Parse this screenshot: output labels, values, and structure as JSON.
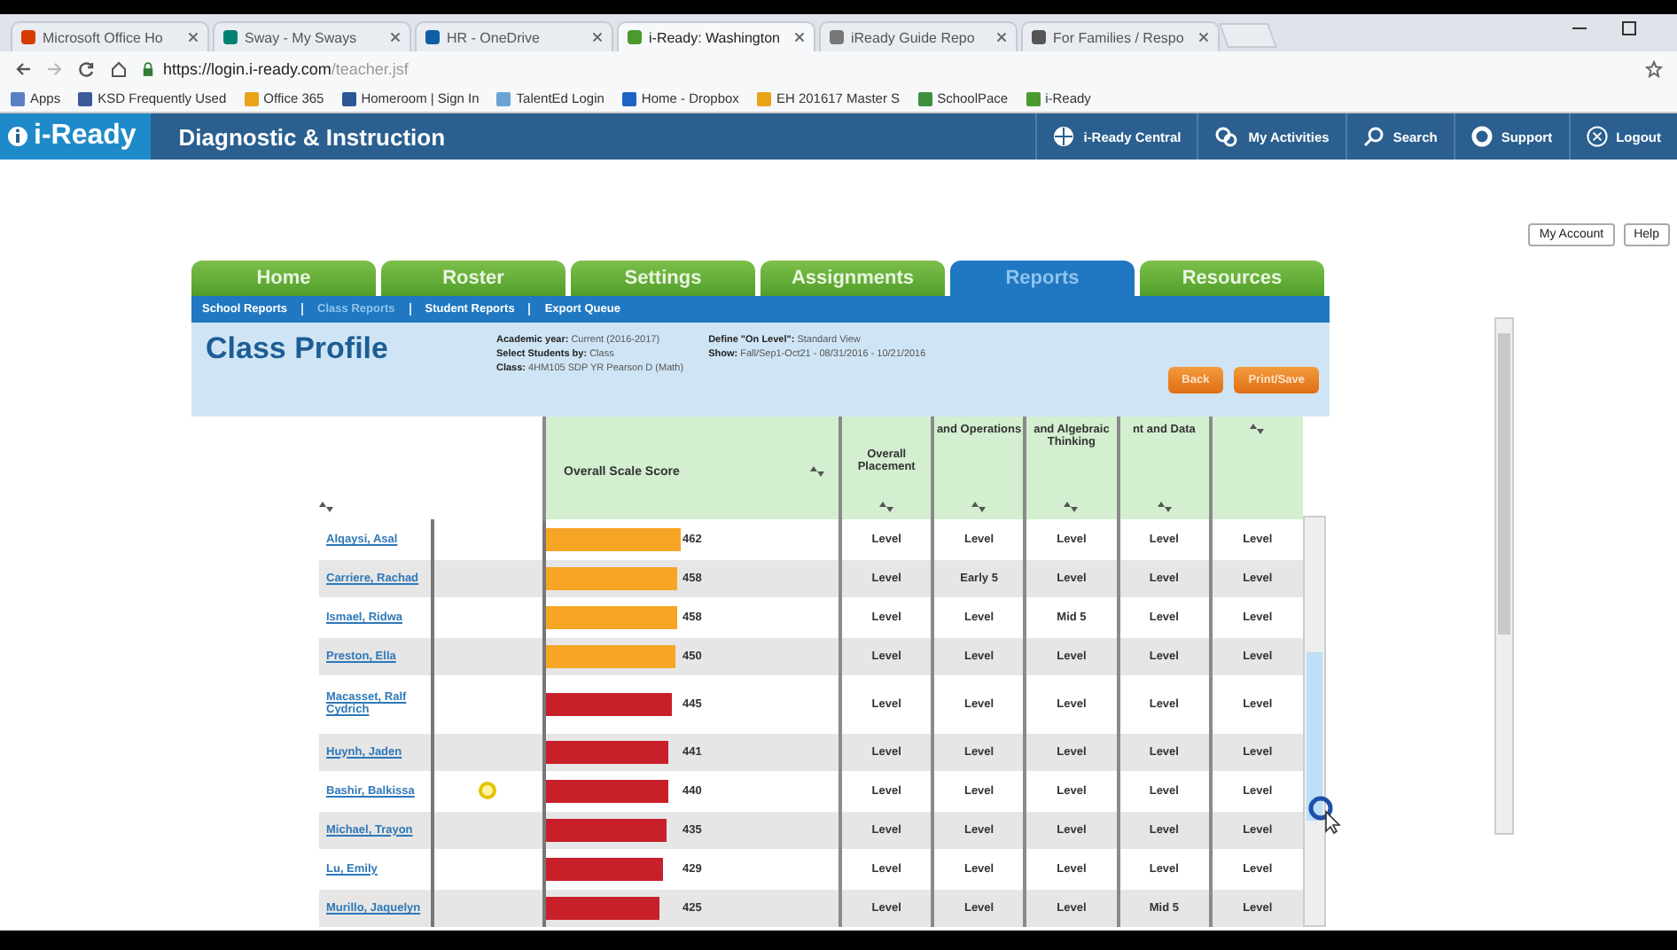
{
  "browser": {
    "tabs": [
      {
        "title": "Microsoft Office Ho",
        "selected": false,
        "color": "#d83b01"
      },
      {
        "title": "Sway - My Sways",
        "selected": false,
        "color": "#008272"
      },
      {
        "title": "HR - OneDrive",
        "selected": false,
        "color": "#0f5ea8"
      },
      {
        "title": "i-Ready: Washington",
        "selected": true,
        "color": "#4a9a2e"
      },
      {
        "title": "iReady Guide Repo",
        "selected": false,
        "color": "#777777"
      },
      {
        "title": "For Families / Respo",
        "selected": false,
        "color": "#555555"
      }
    ],
    "url_host": "https://login.i-ready.com",
    "url_path": "/teacher.jsf",
    "bookmarks": [
      {
        "title": "Apps",
        "color": "#5b7fc4"
      },
      {
        "title": "KSD Frequently Used",
        "color": "#3a5a9a"
      },
      {
        "title": "Office 365",
        "color": "#e8a317"
      },
      {
        "title": "Homeroom | Sign In",
        "color": "#2b5797"
      },
      {
        "title": "TalentEd Login",
        "color": "#6aa3d6"
      },
      {
        "title": "Home - Dropbox",
        "color": "#1e63c4"
      },
      {
        "title": "EH 201617 Master S",
        "color": "#e8a317"
      },
      {
        "title": "SchoolPace",
        "color": "#3f8f3f"
      },
      {
        "title": "i-Ready",
        "color": "#4a9a2e"
      }
    ]
  },
  "app_header": {
    "logo": "i-Ready",
    "title": "Diagnostic & Instruction",
    "nav": [
      "i-Ready Central",
      "My Activities",
      "Search",
      "Support",
      "Logout"
    ]
  },
  "account_buttons": [
    "My Account",
    "Help"
  ],
  "main_tabs": [
    {
      "label": "Home",
      "selected": false
    },
    {
      "label": "Roster",
      "selected": false
    },
    {
      "label": "Settings",
      "selected": false
    },
    {
      "label": "Assignments",
      "selected": false
    },
    {
      "label": "Reports",
      "selected": true
    },
    {
      "label": "Resources",
      "selected": false
    }
  ],
  "sub_nav": [
    {
      "label": "School Reports",
      "selected": false
    },
    {
      "label": "Class Reports",
      "selected": true
    },
    {
      "label": "Student Reports",
      "selected": false
    },
    {
      "label": "Export Queue",
      "selected": false
    }
  ],
  "report": {
    "title": "Class Profile",
    "filters": [
      {
        "label": "Academic year:",
        "value": "Current (2016-2017)"
      },
      {
        "label": "Select Students by:",
        "value": "Class"
      },
      {
        "label": "Class:",
        "value": "4HM105 SDP YR Pearson D (Math)"
      }
    ],
    "filters_right": [
      {
        "label": "Define \"On Level\":",
        "value": "Standard View"
      },
      {
        "label": "Show:",
        "value": "Fall/Sep1-Oct21 - 08/31/2016 - 10/21/2016"
      }
    ],
    "buttons": [
      "Back",
      "Print/Save"
    ]
  },
  "table": {
    "score_header": "Overall Scale Score",
    "columns": [
      "Overall Placement",
      "and Operations",
      "and Algebraic Thinking",
      "nt and Data"
    ],
    "rows": [
      {
        "name": "Alqaysi, Asal",
        "flagged": false,
        "score": "462",
        "level": 0.46,
        "color": "#f6a524",
        "cells": [
          "Level",
          "Level",
          "Level",
          "Level",
          "Level"
        ]
      },
      {
        "name": "Carriere, Rachad",
        "flagged": false,
        "score": "458",
        "level": 0.45,
        "color": "#f6a524",
        "cells": [
          "Level",
          "Early 5",
          "Level",
          "Level",
          "Level"
        ]
      },
      {
        "name": "Ismael, Ridwa",
        "flagged": false,
        "score": "458",
        "level": 0.45,
        "color": "#f6a524",
        "cells": [
          "Level",
          "Level",
          "Mid 5",
          "Level",
          "Level"
        ]
      },
      {
        "name": "Preston, Ella",
        "flagged": false,
        "score": "450",
        "level": 0.44,
        "color": "#f6a524",
        "cells": [
          "Level",
          "Level",
          "Level",
          "Level",
          "Level"
        ]
      },
      {
        "name": "Macasset, Ralf Cydrich",
        "flagged": false,
        "score": "445",
        "level": 0.43,
        "color": "#c8202a",
        "cells": [
          "Level",
          "Level",
          "Level",
          "Level",
          "Level"
        ]
      },
      {
        "name": "Huynh, Jaden",
        "flagged": false,
        "score": "441",
        "level": 0.42,
        "color": "#c8202a",
        "cells": [
          "Level",
          "Level",
          "Level",
          "Level",
          "Level"
        ]
      },
      {
        "name": "Bashir, Balkissa",
        "flagged": true,
        "score": "440",
        "level": 0.42,
        "color": "#c8202a",
        "cells": [
          "Level",
          "Level",
          "Level",
          "Level",
          "Level"
        ]
      },
      {
        "name": "Michael, Trayon",
        "flagged": false,
        "score": "435",
        "level": 0.41,
        "color": "#c8202a",
        "cells": [
          "Level",
          "Level",
          "Level",
          "Level",
          "Level"
        ]
      },
      {
        "name": "Lu, Emily",
        "flagged": false,
        "score": "429",
        "level": 0.4,
        "color": "#c8202a",
        "cells": [
          "Level",
          "Level",
          "Level",
          "Level",
          "Level"
        ]
      },
      {
        "name": "Murillo, Jaquelyn",
        "flagged": false,
        "score": "425",
        "level": 0.39,
        "color": "#c8202a",
        "cells": [
          "Level",
          "Level",
          "Level",
          "Mid 5",
          "Level"
        ]
      }
    ]
  }
}
